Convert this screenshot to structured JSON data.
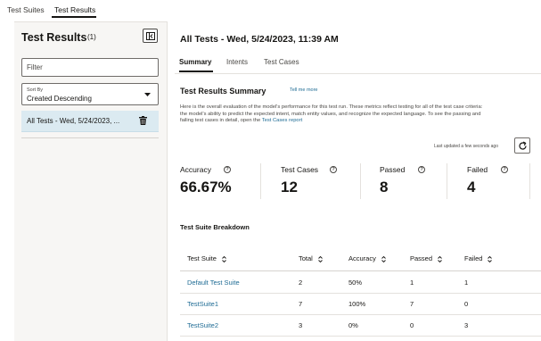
{
  "top_tabs": [
    "Test Suites",
    "Test Results"
  ],
  "left_panel": {
    "title": "Test Results",
    "count": "(1)",
    "filter_placeholder": "Filter",
    "sort_label": "Sort By",
    "sort_value": "Created Descending",
    "items": [
      "All Tests - Wed, 5/24/2023, ..."
    ]
  },
  "main": {
    "title": "All Tests - Wed, 5/24/2023, 11:39 AM",
    "tabs": [
      "Summary",
      "Intents",
      "Test Cases"
    ],
    "summary_title": "Test Results Summary",
    "tell_me_more": "Tell me more",
    "description": "Here is the overall evaluation of the model's performance for this test run. These metrics reflect testing for all of the test case criteria: the model's ability to predict the expected intent, match entity values, and recognize the expected language. To see the passing and failing test cases in detail, open the",
    "description_link": "Test Cases report",
    "last_updated": "Last updated a few seconds ago"
  },
  "metrics": [
    {
      "label": "Accuracy",
      "value": "66.67%",
      "help": true
    },
    {
      "label": "Test Cases",
      "value": "12",
      "help": true
    },
    {
      "label": "Passed",
      "value": "8",
      "help": true
    },
    {
      "label": "Failed",
      "value": "4",
      "help": true
    }
  ],
  "breakdown": {
    "title": "Test Suite Breakdown",
    "columns": [
      "Test Suite",
      "Total",
      "Accuracy",
      "Passed",
      "Failed"
    ],
    "rows": [
      [
        "Default Test Suite",
        "2",
        "50%",
        "1",
        "1"
      ],
      [
        "TestSuite1",
        "7",
        "100%",
        "7",
        "0"
      ],
      [
        "TestSuite2",
        "3",
        "0%",
        "0",
        "3"
      ]
    ]
  },
  "colors": {
    "accent": "#1e6b94",
    "selected_row": "#dbeaf1",
    "panel_bg": "#f7f6f4"
  },
  "icons": [
    "collapse-panel-icon",
    "chevron-down-icon",
    "trash-icon",
    "help-icon",
    "refresh-icon",
    "sort-icon"
  ]
}
